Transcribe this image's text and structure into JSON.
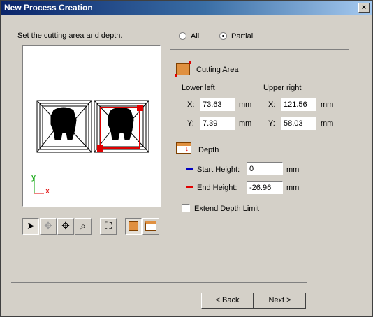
{
  "window": {
    "title": "New Process Creation",
    "close_label": "×"
  },
  "instruction": "Set the cutting area and depth.",
  "mode": {
    "all_label": "All",
    "partial_label": "Partial",
    "selected": "partial"
  },
  "cutting_area": {
    "label": "Cutting Area",
    "lower_left": {
      "heading": "Lower left",
      "x_label": "X:",
      "x": "73.63",
      "y_label": "Y:",
      "y": "7.39"
    },
    "upper_right": {
      "heading": "Upper right",
      "x_label": "X:",
      "x": "121.56",
      "y_label": "Y:",
      "y": "58.03"
    },
    "unit": "mm"
  },
  "depth": {
    "label": "Depth",
    "start_label": "Start Height:",
    "start_value": "0",
    "end_label": "End Height:",
    "end_value": "-26.96",
    "unit": "mm",
    "start_color": "#0000c0",
    "end_color": "#e00000"
  },
  "extend_depth_limit": {
    "label": "Extend Depth Limit",
    "checked": false
  },
  "preview": {
    "axis_y": "y",
    "axis_x": "x",
    "axis_y_color": "#00a000",
    "axis_x_color": "#e00000",
    "selection_color": "#e00000"
  },
  "toolbar": [
    "select-arrow-icon",
    "pan-disabled-icon",
    "move-icon",
    "zoom-icon",
    "fit-icon",
    "cutting-area-tool-icon",
    "depth-tool-icon"
  ],
  "buttons": {
    "back": "< Back",
    "next": "Next >"
  }
}
